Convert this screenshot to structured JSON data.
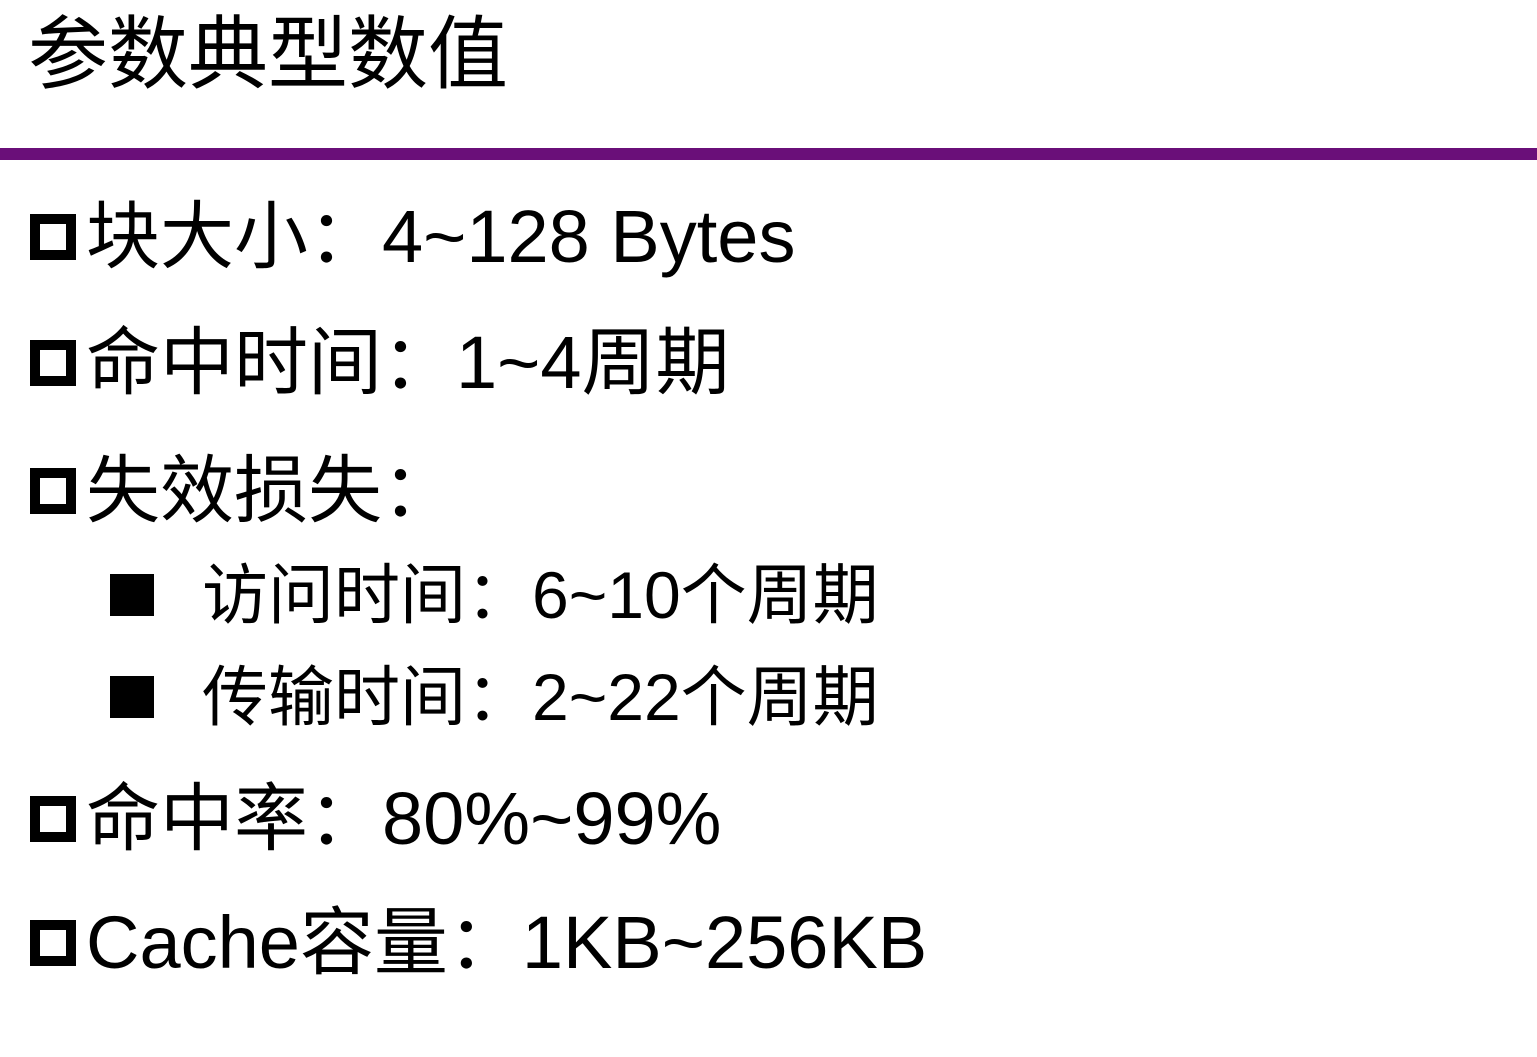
{
  "slide": {
    "title": "参数典型数值",
    "accent_color": "#6a0f79",
    "items": [
      {
        "label": "块大小：4~128 Bytes",
        "bullet": "hollow-square"
      },
      {
        "label": "命中时间：1~4周期",
        "bullet": "hollow-square"
      },
      {
        "label": "失效损失：",
        "bullet": "hollow-square",
        "subitems": [
          {
            "label": "访问时间：6~10个周期",
            "bullet": "filled-square"
          },
          {
            "label": "传输时间：2~22个周期",
            "bullet": "filled-square"
          }
        ]
      },
      {
        "label": "命中率：80%~99%",
        "bullet": "hollow-square"
      },
      {
        "label": "Cache容量：1KB~256KB",
        "bullet": "hollow-square"
      }
    ]
  }
}
